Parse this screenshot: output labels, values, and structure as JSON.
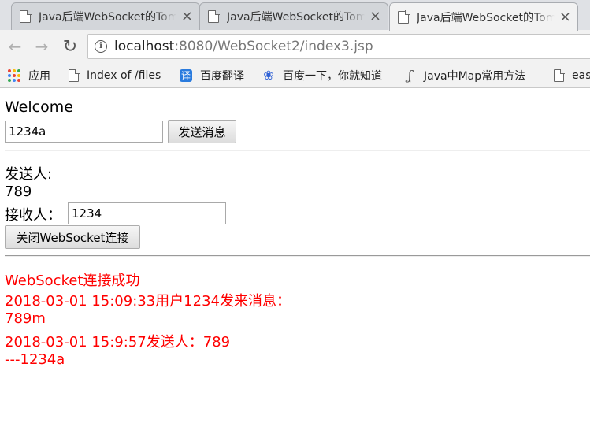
{
  "browser": {
    "tabs": [
      {
        "title": "Java后端WebSocket的Tomcat实现",
        "close": "×"
      },
      {
        "title": "Java后端WebSocket的Tomcat实现",
        "close": "×"
      },
      {
        "title": "Java后端WebSocket的Tomcat实现",
        "close": "×"
      }
    ],
    "active_tab": 2,
    "nav": {
      "back": "←",
      "forward": "→",
      "reload": "↻"
    },
    "url_host": "localhost",
    "url_rest": ":8080/WebSocket2/index3.jsp",
    "bookmarks": [
      {
        "label": "应用",
        "icon": "apps-icon"
      },
      {
        "label": "Index of /files",
        "icon": "document-icon"
      },
      {
        "label": "百度翻译",
        "icon": "translate-icon"
      },
      {
        "label": "百度一下，你就知道",
        "icon": "baidu-paw-icon"
      },
      {
        "label": "Java中Map常用方法",
        "icon": "java-icon"
      },
      {
        "label": "eas",
        "icon": "document-icon"
      }
    ],
    "apps_icon_colors": [
      "#ea4335",
      "#fbbc05",
      "#34a853",
      "#4285f4",
      "#ea4335",
      "#fbbc05",
      "#34a853",
      "#4285f4",
      "#ea4335"
    ]
  },
  "page": {
    "welcome": "Welcome",
    "message_input_value": "1234a",
    "send_button": "发送消息",
    "sender_label": "发送人:",
    "sender_value": "789",
    "receiver_label": "接收人：",
    "receiver_input_value": "1234",
    "close_button": "关闭WebSocket连接",
    "messages": [
      "WebSocket连接成功",
      "2018-03-01 15:09:33用户1234发来消息：",
      "789m",
      "2018-03-01 15:9:57发送人：789",
      "---1234a"
    ],
    "message_color": "#ff0000"
  }
}
